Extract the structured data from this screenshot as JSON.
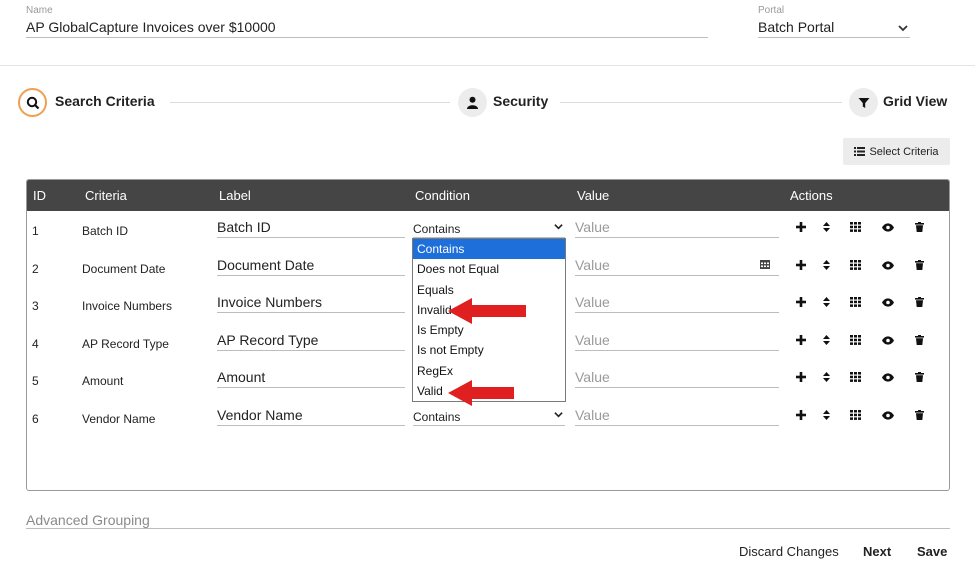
{
  "header": {
    "name_label": "Name",
    "name_value": "AP GlobalCapture Invoices over $10000",
    "portal_label": "Portal",
    "portal_value": "Batch Portal"
  },
  "steps": [
    {
      "label": "Search Criteria",
      "icon": "search-icon",
      "active": true
    },
    {
      "label": "Security",
      "icon": "user-icon",
      "active": false
    },
    {
      "label": "Grid View",
      "icon": "filter-icon",
      "active": false
    }
  ],
  "toolbar": {
    "select_criteria_label": "Select Criteria"
  },
  "grid": {
    "columns": [
      "ID",
      "Criteria",
      "Label",
      "Condition",
      "Value",
      "Actions"
    ],
    "value_placeholder": "Value",
    "rows": [
      {
        "id": "1",
        "criteria": "Batch ID",
        "label": "Batch ID",
        "condition": "Contains",
        "value": "",
        "has_calendar": false
      },
      {
        "id": "2",
        "criteria": "Document Date",
        "label": "Document Date",
        "condition": "",
        "value": "",
        "has_calendar": true
      },
      {
        "id": "3",
        "criteria": "Invoice Numbers",
        "label": "Invoice Numbers",
        "condition": "",
        "value": "",
        "has_calendar": false
      },
      {
        "id": "4",
        "criteria": "AP Record Type",
        "label": "AP Record Type",
        "condition": "",
        "value": "",
        "has_calendar": false
      },
      {
        "id": "5",
        "criteria": "Amount",
        "label": "Amount",
        "condition": "",
        "value": "",
        "has_calendar": false
      },
      {
        "id": "6",
        "criteria": "Vendor Name",
        "label": "Vendor Name",
        "condition": "Contains",
        "value": "",
        "has_calendar": false
      }
    ]
  },
  "condition_dropdown": {
    "options": [
      "Contains",
      "Does not Equal",
      "Equals",
      "Invalid",
      "Is Empty",
      "Is not Empty",
      "RegEx",
      "Valid"
    ],
    "selected": "Contains",
    "highlighted_by_arrows": [
      "Invalid",
      "Valid"
    ],
    "arrow_color": "#e02020"
  },
  "advanced_grouping_label": "Advanced Grouping",
  "footer": {
    "discard_label": "Discard Changes",
    "next_label": "Next",
    "save_label": "Save"
  },
  "colors": {
    "active_step_ring": "#f0a050",
    "grid_header": "#454545",
    "dropdown_selected": "#1e6fd9"
  }
}
